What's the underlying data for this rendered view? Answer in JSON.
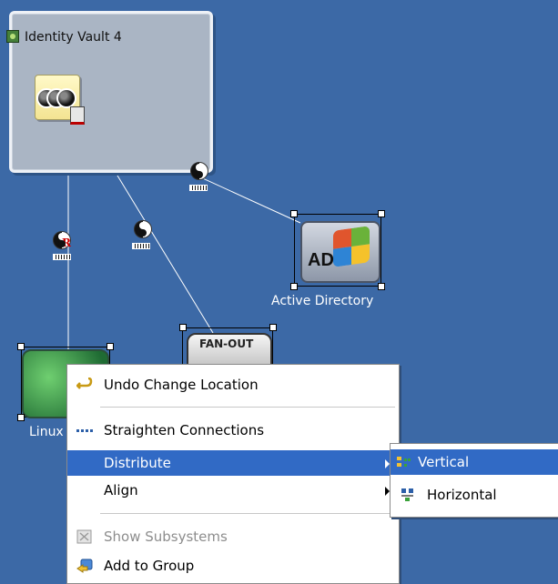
{
  "canvas": {
    "vault": {
      "title": "Identity Vault 4"
    },
    "nodes": {
      "active_directory": {
        "label": "Active Directory",
        "icon_text": "AD"
      },
      "linux": {
        "label": "Linux"
      },
      "fanout": {
        "label": "FAN-OUT"
      }
    }
  },
  "context_menu": {
    "items": [
      {
        "label": "Undo Change Location",
        "icon": "undo-icon"
      },
      {
        "label": "Straighten Connections",
        "icon": "straighten-icon"
      },
      {
        "label": "Distribute",
        "has_submenu": true,
        "selected": true
      },
      {
        "label": "Align",
        "has_submenu": true
      },
      {
        "label": "Show Subsystems",
        "icon": "subsystems-icon",
        "disabled": true
      },
      {
        "label": "Add to Group",
        "icon": "group-icon"
      }
    ]
  },
  "submenu": {
    "items": [
      {
        "label": "Vertical",
        "icon": "distribute-vertical-icon",
        "selected": true
      },
      {
        "label": "Horizontal",
        "icon": "distribute-horizontal-icon"
      }
    ]
  },
  "colors": {
    "canvas_bg": "#3c69a6",
    "menu_highlight": "#316ac5"
  }
}
